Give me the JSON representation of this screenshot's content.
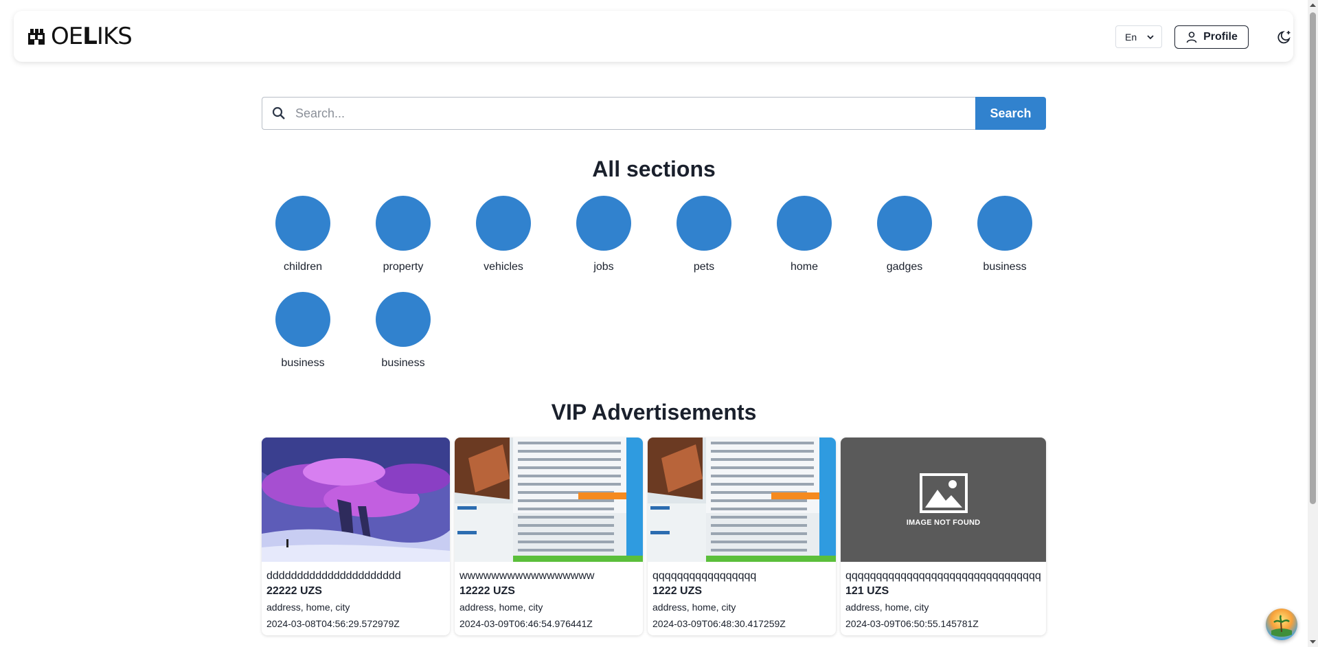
{
  "header": {
    "logo_text_light": "OE",
    "logo_text_bold": "L",
    "logo_text_rest": "IKS",
    "language": "En",
    "profile_label": "Profile"
  },
  "search": {
    "placeholder": "Search...",
    "button_label": "Search"
  },
  "sections": {
    "title": "All sections",
    "items": [
      {
        "label": "children"
      },
      {
        "label": "property"
      },
      {
        "label": "vehicles"
      },
      {
        "label": "jobs"
      },
      {
        "label": "pets"
      },
      {
        "label": "home"
      },
      {
        "label": "gadges"
      },
      {
        "label": "business"
      },
      {
        "label": "business"
      },
      {
        "label": "business"
      }
    ]
  },
  "vip": {
    "title": "VIP Advertisements",
    "ads": [
      {
        "title": "dddddddddddddddddddddd",
        "price": "22222 UZS",
        "address": "address, home, city",
        "date": "2024-03-08T04:56:29.572979Z",
        "image": "fantasy-art"
      },
      {
        "title": "wwwwwwwwwwwwwwwww",
        "price": "12222 UZS",
        "address": "address, home, city",
        "date": "2024-03-09T06:46:54.976441Z",
        "image": "screenshot"
      },
      {
        "title": "qqqqqqqqqqqqqqqqq",
        "price": "1222 UZS",
        "address": "address, home, city",
        "date": "2024-03-09T06:48:30.417259Z",
        "image": "screenshot"
      },
      {
        "title": "qqqqqqqqqqqqqqqqqqqqqqqqqqqqqqqqq",
        "price": "121 UZS",
        "address": "address, home, city",
        "date": "2024-03-09T06:50:55.145781Z",
        "image": "not-found",
        "image_text": "IMAGE NOT FOUND"
      }
    ]
  },
  "colors": {
    "accent": "#3182ce",
    "text": "#1a202c",
    "placeholder_bg": "#5a5a5a"
  }
}
